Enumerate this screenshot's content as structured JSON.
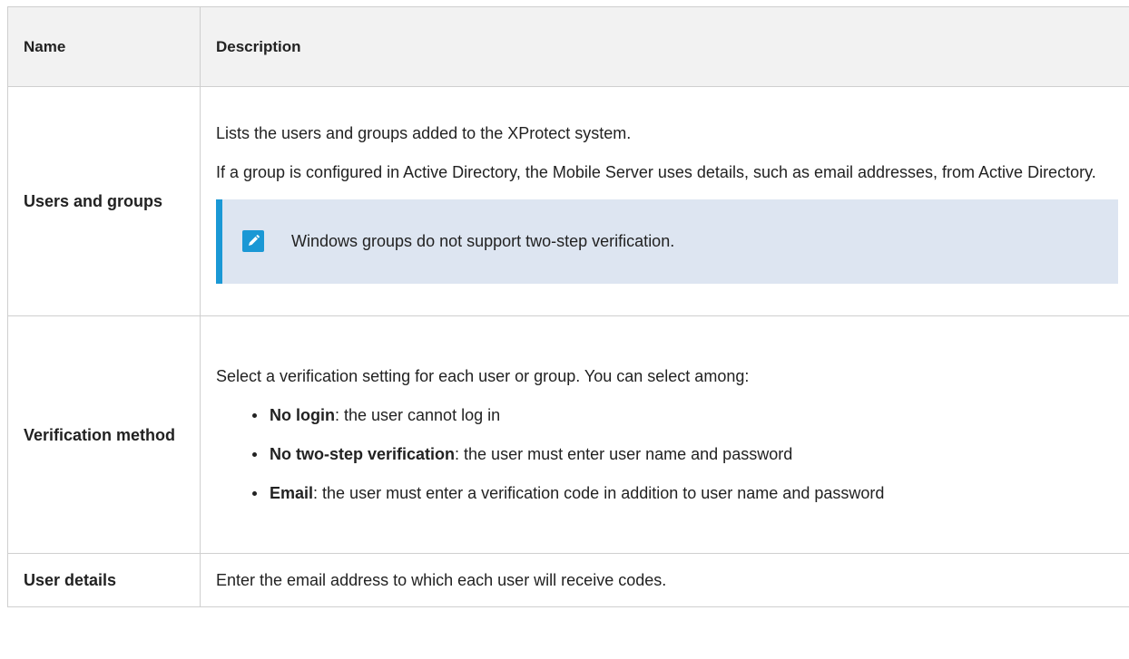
{
  "table": {
    "headers": {
      "name": "Name",
      "description": "Description"
    },
    "rows": [
      {
        "name": "Users and groups",
        "paragraphs": [
          "Lists the users and groups added to the XProtect system.",
          "If a group is configured in Active Directory, the Mobile Server uses details, such as email addresses, from Active Directory."
        ],
        "note": {
          "icon": "pencil-icon",
          "text": "Windows groups do not support two-step verification."
        }
      },
      {
        "name": "Verification method",
        "intro": "Select a verification setting for each user or group. You can select among:",
        "options": [
          {
            "term": "No login",
            "text": ": the user cannot log in"
          },
          {
            "term": "No two-step verification",
            "text": ": the user must enter user name and password"
          },
          {
            "term": "Email",
            "text": ": the user must enter a verification code in addition to user name and password"
          }
        ]
      },
      {
        "name": "User details",
        "text": "Enter the email address to which each user will receive codes."
      }
    ]
  },
  "colors": {
    "note_accent": "#1a98d5",
    "note_background": "#dde5f1",
    "header_background": "#f2f2f2",
    "border": "#cfcfcf"
  }
}
